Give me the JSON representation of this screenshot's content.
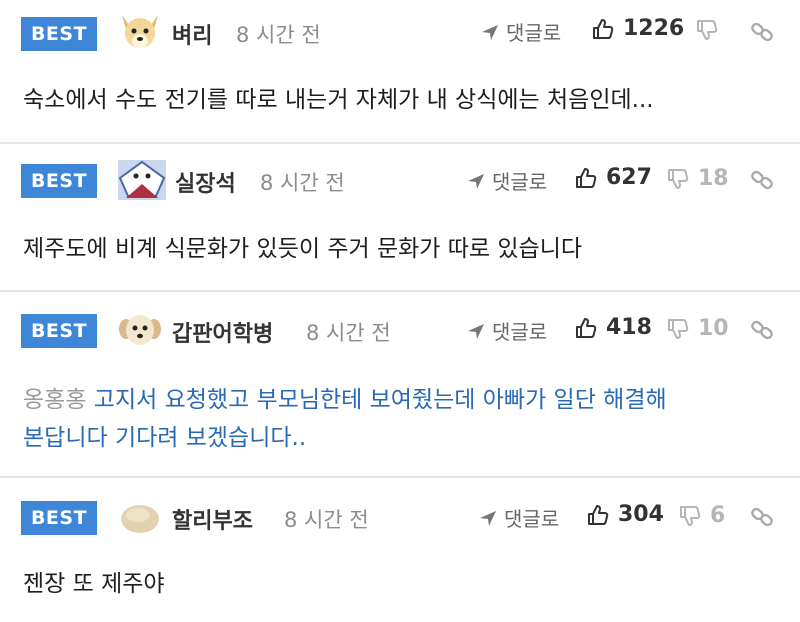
{
  "comments": [
    {
      "badge": "BEST",
      "nick": "벼리",
      "time": "8 시간 전",
      "reply_label": "댓글로",
      "likes": "1226",
      "dislikes": "",
      "text": "숙소에서 수도 전기를 따로 내는거 자체가 내 상식에는 처음인데..."
    },
    {
      "badge": "BEST",
      "nick": "실장석",
      "time": "8 시간 전",
      "reply_label": "댓글로",
      "likes": "627",
      "dislikes": "18",
      "text": "제주도에 비계 식문화가 있듯이 주거 문화가 따로 있습니다"
    },
    {
      "badge": "BEST",
      "nick": "갑판어학병",
      "time": "8 시간 전",
      "reply_label": "댓글로",
      "likes": "418",
      "dislikes": "10",
      "mention": "옹홍홍",
      "text_line1": "고지서 요청했고 부모님한테 보여줬는데 아빠가 일단 해결해",
      "text_line2": "본답니다 기다려 보겠습니다.."
    },
    {
      "badge": "BEST",
      "nick": "할리부조",
      "time": "8 시간 전",
      "reply_label": "댓글로",
      "likes": "304",
      "dislikes": "6",
      "text": "젠장 또 제주야"
    }
  ],
  "colors": {
    "best_badge": "#3d86d8",
    "link_text": "#2a6ab4",
    "muted": "#8c8c8c"
  }
}
